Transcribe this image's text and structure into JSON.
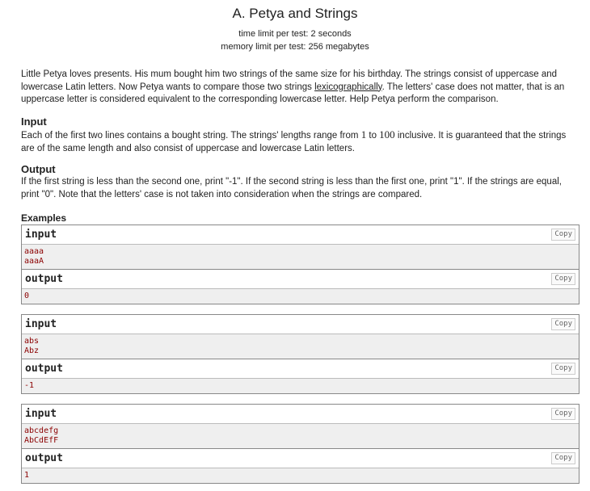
{
  "problem": {
    "title": "A. Petya and Strings",
    "time_limit": "time limit per test: 2 seconds",
    "memory_limit": "memory limit per test: 256 megabytes"
  },
  "statement": {
    "p1_a": "Little Petya loves presents. His mum bought him two strings of the same size for his birthday. The strings consist of uppercase and lowercase Latin letters. Now Petya wants to compare those two strings ",
    "p1_link": "lexicographically",
    "p1_b": ". The letters' case does not matter, that is an uppercase letter is considered equivalent to the corresponding lowercase letter. Help Petya perform the comparison."
  },
  "input_section": {
    "title": "Input",
    "text_a": "Each of the first two lines contains a bought string. The strings' lengths range from ",
    "min": "1",
    "text_b": " to ",
    "max": "100",
    "text_c": " inclusive. It is guaranteed that the strings are of the same length and also consist of uppercase and lowercase Latin letters."
  },
  "output_section": {
    "title": "Output",
    "text": "If the first string is less than the second one, print \"-1\". If the second string is less than the first one, print \"1\". If the strings are equal, print \"0\". Note that the letters' case is not taken into consideration when the strings are compared."
  },
  "examples": {
    "label": "Examples",
    "input_label": "input",
    "output_label": "output",
    "copy_label": "Copy",
    "ex1": {
      "input": "aaaa\naaaA",
      "output": "0"
    },
    "ex2": {
      "input": "abs\nAbz",
      "output": "-1"
    },
    "ex3": {
      "input": "abcdefg\nAbCdEfF",
      "output": "1"
    }
  }
}
